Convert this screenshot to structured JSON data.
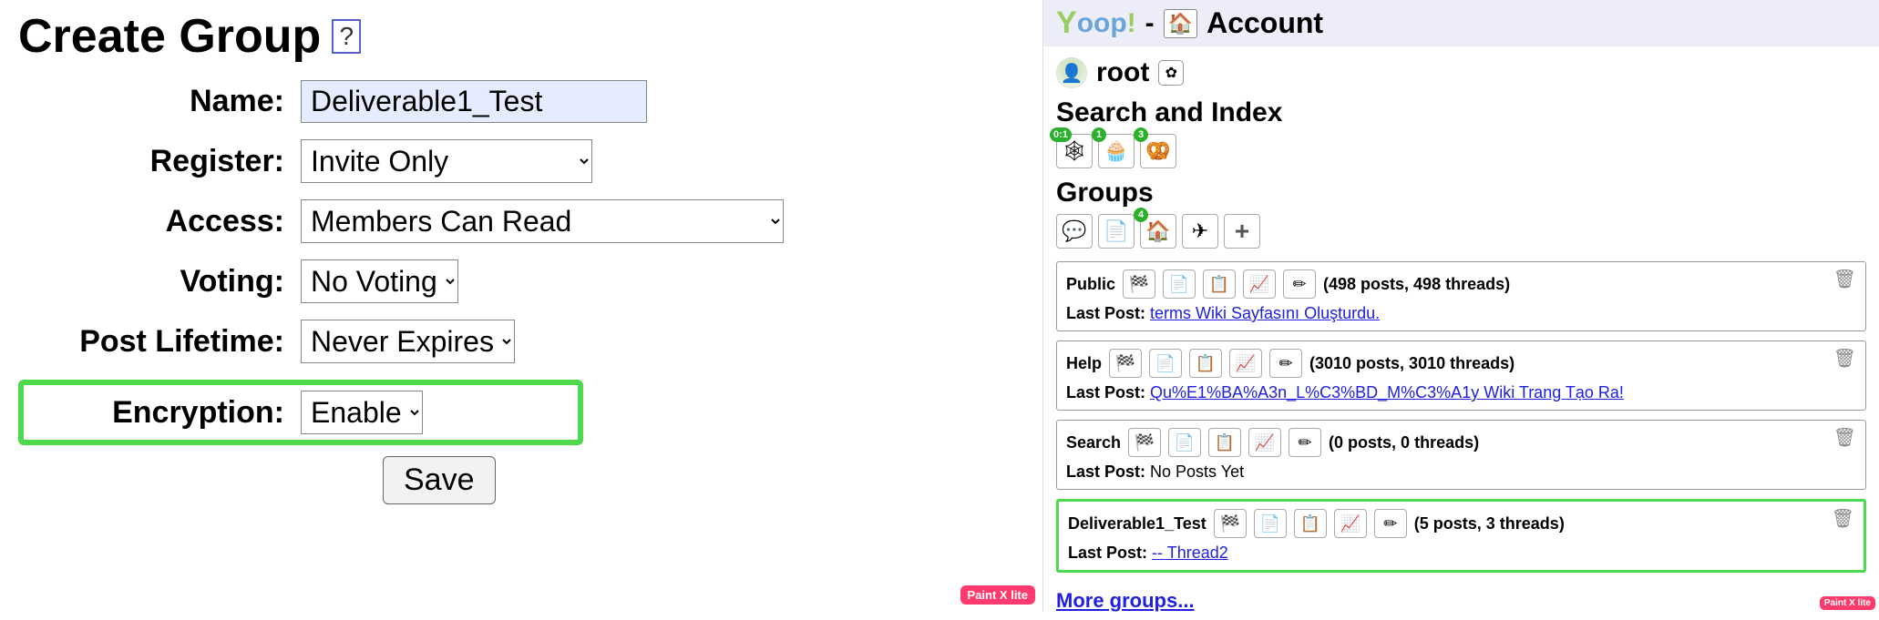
{
  "left": {
    "title": "Create Group",
    "help_glyph": "?",
    "fields": {
      "name": {
        "label": "Name:",
        "value": "Deliverable1_Test"
      },
      "register": {
        "label": "Register:",
        "selected": "Invite Only"
      },
      "access": {
        "label": "Access:",
        "selected": "Members Can Read"
      },
      "voting": {
        "label": "Voting:",
        "selected": "No Voting"
      },
      "post_lifetime": {
        "label": "Post Lifetime:",
        "selected": "Never Expires"
      },
      "encryption": {
        "label": "Encryption:",
        "selected": "Enable"
      }
    },
    "save_label": "Save",
    "watermark": "Paint X lite"
  },
  "right": {
    "logo_text": "Yoop!",
    "dash": "-",
    "home_glyph": "🏠",
    "account_label": "Account",
    "user": {
      "name": "root",
      "gear_glyph": "✿"
    },
    "search_index_title": "Search and Index",
    "search_index_icons": [
      {
        "badge": "0:1",
        "glyph": "🕸"
      },
      {
        "badge": "1",
        "glyph": "🧁"
      },
      {
        "badge": "3",
        "glyph": "🥨"
      }
    ],
    "groups_title": "Groups",
    "groups_toolbar": [
      {
        "badge": "",
        "glyph": "💬"
      },
      {
        "badge": "",
        "glyph": "📄"
      },
      {
        "badge": "4",
        "glyph": "🏠"
      },
      {
        "badge": "",
        "glyph": "✈"
      },
      {
        "badge": "",
        "glyph": "+"
      }
    ],
    "groups": [
      {
        "name": "Public",
        "counts": "(498 posts, 498 threads)",
        "last_post_label": "Last Post:",
        "last_post_link": "terms Wiki Sayfasını Oluşturdu.",
        "no_posts": "",
        "highlighted": false
      },
      {
        "name": "Help",
        "counts": "(3010 posts, 3010 threads)",
        "last_post_label": "Last Post:",
        "last_post_link": "Qu%E1%BA%A3n_L%C3%BD_M%C3%A1y Wiki Trang Tạo Ra!",
        "no_posts": "",
        "highlighted": false
      },
      {
        "name": "Search",
        "counts": "(0 posts, 0 threads)",
        "last_post_label": "Last Post:",
        "last_post_link": "",
        "no_posts": "No Posts Yet",
        "highlighted": false
      },
      {
        "name": "Deliverable1_Test",
        "counts": "(5 posts, 3 threads)",
        "last_post_label": "Last Post:",
        "last_post_link": "-- Thread2",
        "no_posts": "",
        "highlighted": true
      }
    ],
    "group_action_glyphs": [
      "🏁",
      "📄",
      "📋",
      "📈",
      "✏"
    ],
    "trash_glyph": "🗑",
    "more_groups": "More groups...",
    "watermark": "Paint X lite"
  }
}
